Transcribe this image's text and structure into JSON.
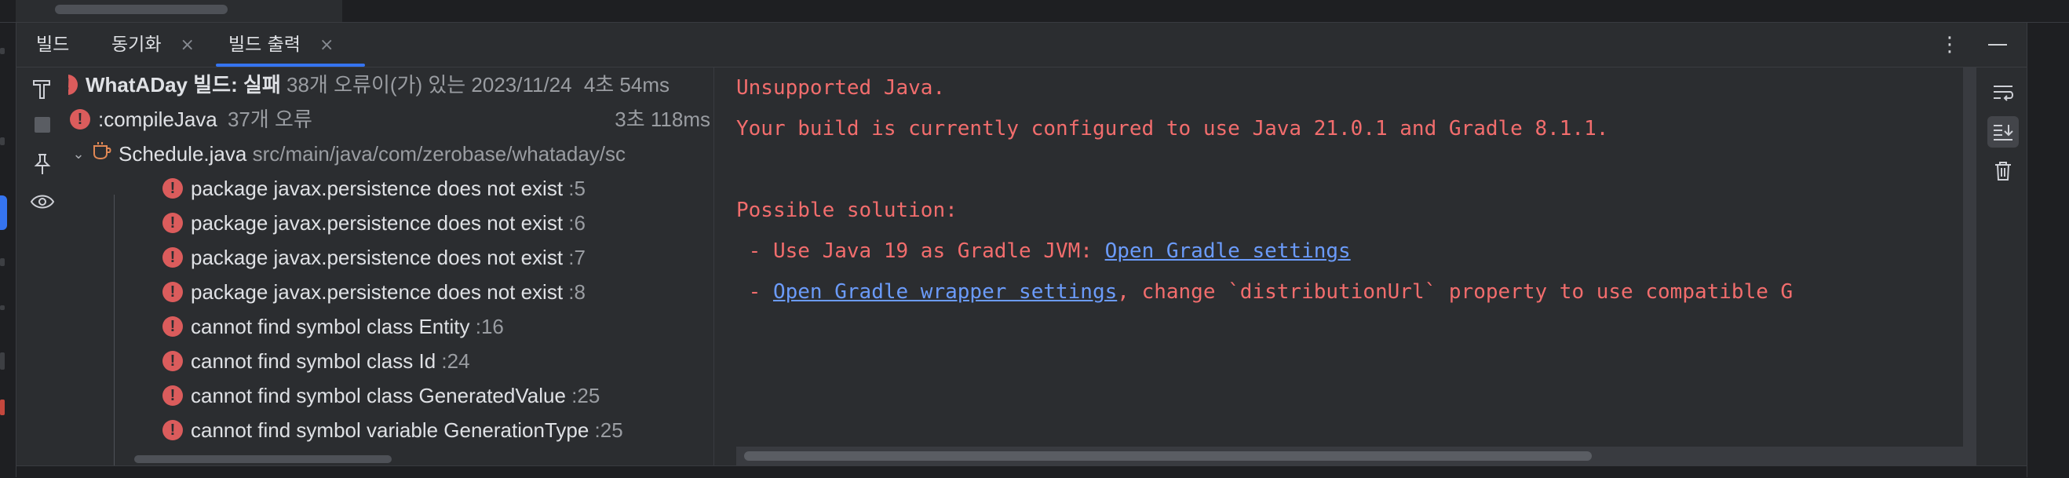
{
  "tabs": [
    {
      "label": "빌드",
      "closable": false
    },
    {
      "label": "동기화",
      "closable": true
    },
    {
      "label": "빌드 출력",
      "closable": true,
      "active": true
    }
  ],
  "icons": {
    "close": "×",
    "more": "⋮",
    "chevron_down": "⌄",
    "error": "!"
  },
  "tree": {
    "root": {
      "title": "WhatADay 빌드: 실패",
      "detail": "38개 오류이(가) 있는 2023/11/24",
      "duration": "4초 54ms"
    },
    "task": {
      "title": ":compileJava",
      "detail": "37개 오류",
      "duration": "3초 118ms"
    },
    "file": {
      "title": "Schedule.java",
      "path": "src/main/java/com/zerobase/whataday/sc"
    },
    "errors": [
      {
        "message": "package javax.persistence does not exist",
        "line": ":5"
      },
      {
        "message": "package javax.persistence does not exist",
        "line": ":6"
      },
      {
        "message": "package javax.persistence does not exist",
        "line": ":7"
      },
      {
        "message": "package javax.persistence does not exist",
        "line": ":8"
      },
      {
        "message": "cannot find symbol class Entity",
        "line": ":16"
      },
      {
        "message": "cannot find symbol class Id",
        "line": ":24"
      },
      {
        "message": "cannot find symbol class GeneratedValue",
        "line": ":25"
      },
      {
        "message": "cannot find symbol variable GenerationType",
        "line": ":25"
      }
    ]
  },
  "console": {
    "line1": "Unsupported Java.",
    "line2": "Your build is currently configured to use Java 21.0.1 and Gradle 8.1.1.",
    "line4": "Possible solution:",
    "line5_prefix": " - Use Java 19 as Gradle JVM: ",
    "line5_link": "Open Gradle settings",
    "line6_prefix": " - ",
    "line6_link": "Open Gradle wrapper settings",
    "line6_suffix": ", change `distributionUrl` property to use compatible G"
  },
  "colors": {
    "accent": "#3574f0",
    "error_text": "#f26d6d",
    "link": "#6b9bfa",
    "error_badge": "#db5c5c"
  }
}
